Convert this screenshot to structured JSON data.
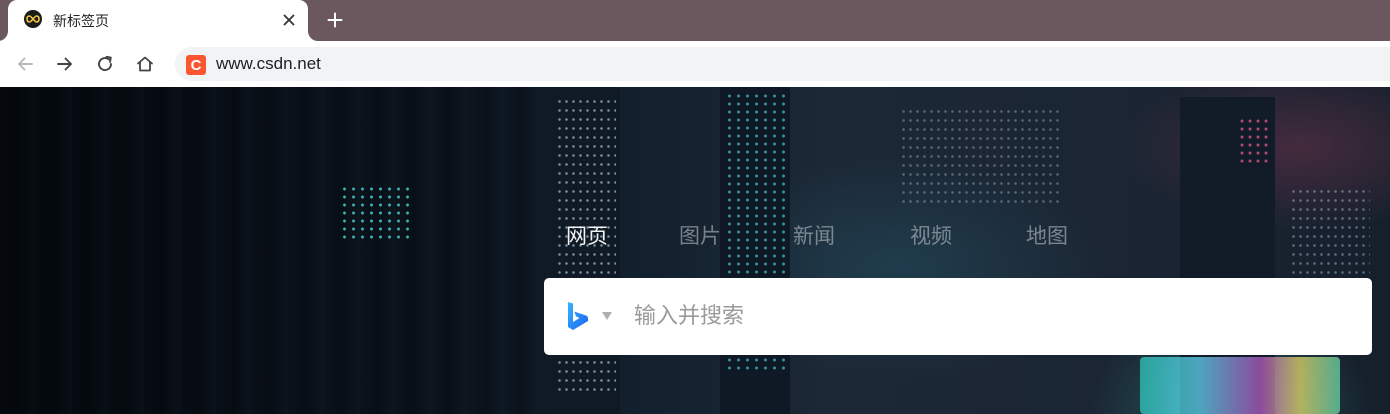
{
  "browser": {
    "tab": {
      "title": "新标签页",
      "favicon": "infinity-icon"
    },
    "new_tab_icon": "plus-icon",
    "toolbar": {
      "back_icon": "arrow-left-icon",
      "forward_icon": "arrow-right-icon",
      "reload_icon": "reload-icon",
      "home_icon": "home-icon",
      "site_icon": "csdn-icon",
      "site_icon_letter": "C",
      "url": "www.csdn.net"
    }
  },
  "page": {
    "nav_tabs": [
      {
        "label": "网页",
        "active": true
      },
      {
        "label": "图片",
        "active": false
      },
      {
        "label": "新闻",
        "active": false
      },
      {
        "label": "视频",
        "active": false
      },
      {
        "label": "地图",
        "active": false
      }
    ],
    "search": {
      "engine_icon": "bing-icon",
      "placeholder": "输入并搜索",
      "value": ""
    }
  },
  "colors": {
    "tabstrip": "#6b585e",
    "csdn_brand": "#fc5531",
    "bing_blue": "#1a8cff"
  }
}
